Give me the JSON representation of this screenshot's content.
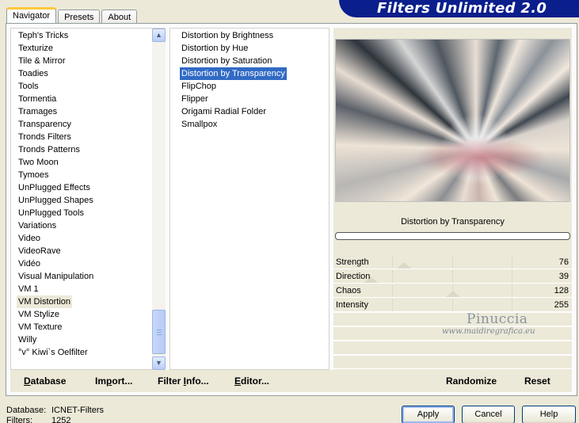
{
  "tabs": [
    "Navigator",
    "Presets",
    "About"
  ],
  "header": {
    "title": "Filters Unlimited 2.0"
  },
  "categories": [
    "Teph's Tricks",
    "Texturize",
    "Tile & Mirror",
    "Toadies",
    "Tools",
    "Tormentia",
    "Tramages",
    "Transparency",
    "Tronds Filters",
    "Tronds Patterns",
    "Two Moon",
    "Tymoes",
    "UnPlugged Effects",
    "UnPlugged Shapes",
    "UnPlugged Tools",
    "Variations",
    "Video",
    "VideoRave",
    "Vidéo",
    "Visual Manipulation",
    "VM 1",
    "VM Distortion",
    "VM Stylize",
    "VM Texture",
    "Willy",
    "°v° Kiwi`s Oelfilter"
  ],
  "selected_category": "VM Distortion",
  "filters": [
    "Distortion by Brightness",
    "Distortion by Hue",
    "Distortion by Saturation",
    "Distortion by Transparency",
    "FlipChop",
    "Flipper",
    "Origami Radial Folder",
    "Smallpox"
  ],
  "selected_filter": "Distortion by Transparency",
  "current_filter_label": "Distortion by Transparency",
  "params": [
    {
      "name": "Strength",
      "value": "76"
    },
    {
      "name": "Direction",
      "value": "39"
    },
    {
      "name": "Chaos",
      "value": "128"
    },
    {
      "name": "Intensity",
      "value": "255"
    }
  ],
  "watermark": {
    "name": "Pinuccia",
    "site": "www.maidiregrafica.eu"
  },
  "bottom_buttons": {
    "database": {
      "underline": "D",
      "rest": "atabase"
    },
    "import": {
      "prefix": "Im",
      "underline": "p",
      "rest": "ort..."
    },
    "filter_info": {
      "prefix": "Filter ",
      "underline": "I",
      "rest": "nfo..."
    },
    "editor": {
      "underline": "E",
      "rest": "ditor..."
    },
    "randomize": "Randomize",
    "reset": "Reset"
  },
  "footer": {
    "database_label": "Database:",
    "database_value": "ICNET-Filters",
    "filters_label": "Filters:",
    "filters_value": "1252"
  },
  "dialog_buttons": {
    "apply": "Apply",
    "cancel": "Cancel",
    "help": "Help"
  }
}
